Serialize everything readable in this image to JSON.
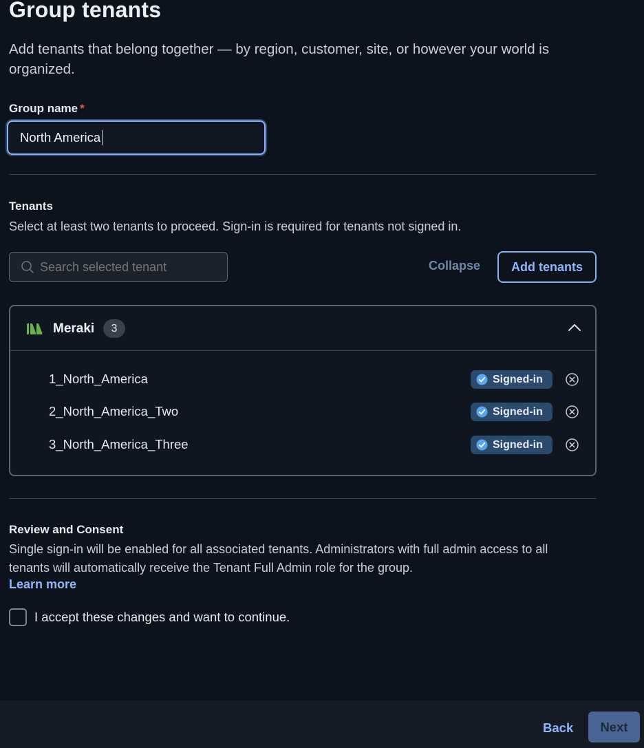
{
  "page": {
    "title": "Group tenants",
    "subtitle": "Add tenants that belong together — by region, customer, site, or however your world is organized."
  },
  "group_name": {
    "label": "Group name",
    "required_marker": "*",
    "value": "North America"
  },
  "tenants": {
    "title": "Tenants",
    "description": "Select at least two tenants to proceed. Sign-in is required for tenants not signed in.",
    "search_placeholder": "Search selected tenant",
    "collapse_label": "Collapse",
    "add_label": "Add tenants",
    "group": {
      "name": "Meraki",
      "count": "3",
      "logo_icon": "meraki-logo-icon",
      "items": [
        {
          "name": "1_North_America",
          "status": "Signed-in"
        },
        {
          "name": "2_North_America_Two",
          "status": "Signed-in"
        },
        {
          "name": "3_North_America_Three",
          "status": "Signed-in"
        }
      ]
    }
  },
  "review": {
    "title": "Review and Consent",
    "text": "Single sign-in will be enabled for all associated tenants. Administrators with full admin access to all tenants will automatically receive the Tenant Full Admin role for the group.",
    "learn_more": "Learn more",
    "accept_label": "I accept these changes and want to continue.",
    "accepted": false
  },
  "footer": {
    "back_label": "Back",
    "next_label": "Next"
  },
  "colors": {
    "background": "#0d131c",
    "accent": "#8fb6fb",
    "signed_badge": "#2b4a6d",
    "meraki_green": "#67b346",
    "required": "#e5574f"
  }
}
